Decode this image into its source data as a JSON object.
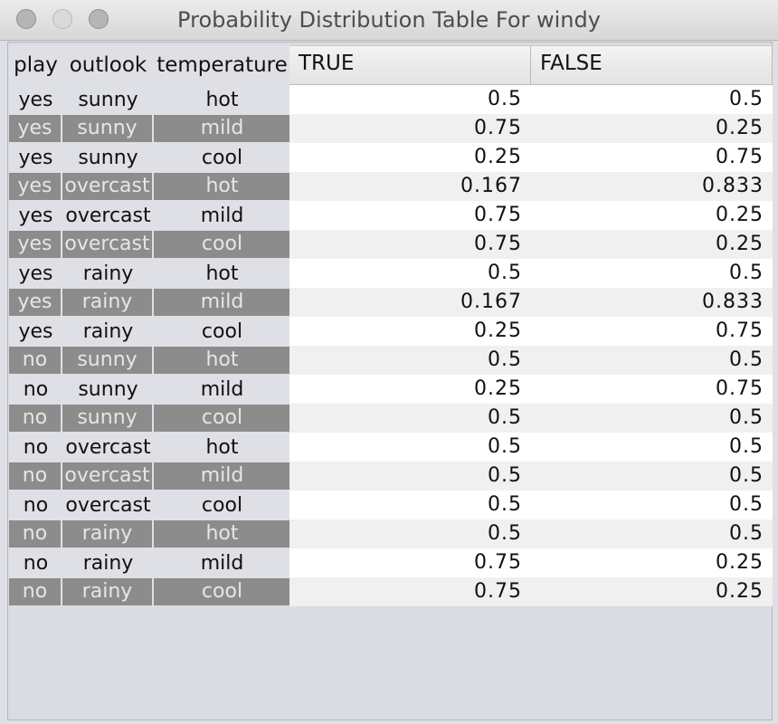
{
  "window": {
    "title": "Probability Distribution Table For windy"
  },
  "columns": {
    "play": "play",
    "outlook": "outlook",
    "temperature": "temperature",
    "true_col": "TRUE",
    "false_col": "FALSE"
  },
  "rows": [
    {
      "play": "yes",
      "outlook": "sunny",
      "temperature": "hot",
      "true_val": "0.5",
      "false_val": "0.5"
    },
    {
      "play": "yes",
      "outlook": "sunny",
      "temperature": "mild",
      "true_val": "0.75",
      "false_val": "0.25"
    },
    {
      "play": "yes",
      "outlook": "sunny",
      "temperature": "cool",
      "true_val": "0.25",
      "false_val": "0.75"
    },
    {
      "play": "yes",
      "outlook": "overcast",
      "temperature": "hot",
      "true_val": "0.167",
      "false_val": "0.833"
    },
    {
      "play": "yes",
      "outlook": "overcast",
      "temperature": "mild",
      "true_val": "0.75",
      "false_val": "0.25"
    },
    {
      "play": "yes",
      "outlook": "overcast",
      "temperature": "cool",
      "true_val": "0.75",
      "false_val": "0.25"
    },
    {
      "play": "yes",
      "outlook": "rainy",
      "temperature": "hot",
      "true_val": "0.5",
      "false_val": "0.5"
    },
    {
      "play": "yes",
      "outlook": "rainy",
      "temperature": "mild",
      "true_val": "0.167",
      "false_val": "0.833"
    },
    {
      "play": "yes",
      "outlook": "rainy",
      "temperature": "cool",
      "true_val": "0.25",
      "false_val": "0.75"
    },
    {
      "play": "no",
      "outlook": "sunny",
      "temperature": "hot",
      "true_val": "0.5",
      "false_val": "0.5"
    },
    {
      "play": "no",
      "outlook": "sunny",
      "temperature": "mild",
      "true_val": "0.25",
      "false_val": "0.75"
    },
    {
      "play": "no",
      "outlook": "sunny",
      "temperature": "cool",
      "true_val": "0.5",
      "false_val": "0.5"
    },
    {
      "play": "no",
      "outlook": "overcast",
      "temperature": "hot",
      "true_val": "0.5",
      "false_val": "0.5"
    },
    {
      "play": "no",
      "outlook": "overcast",
      "temperature": "mild",
      "true_val": "0.5",
      "false_val": "0.5"
    },
    {
      "play": "no",
      "outlook": "overcast",
      "temperature": "cool",
      "true_val": "0.5",
      "false_val": "0.5"
    },
    {
      "play": "no",
      "outlook": "rainy",
      "temperature": "hot",
      "true_val": "0.5",
      "false_val": "0.5"
    },
    {
      "play": "no",
      "outlook": "rainy",
      "temperature": "mild",
      "true_val": "0.75",
      "false_val": "0.25"
    },
    {
      "play": "no",
      "outlook": "rainy",
      "temperature": "cool",
      "true_val": "0.75",
      "false_val": "0.25"
    }
  ]
}
